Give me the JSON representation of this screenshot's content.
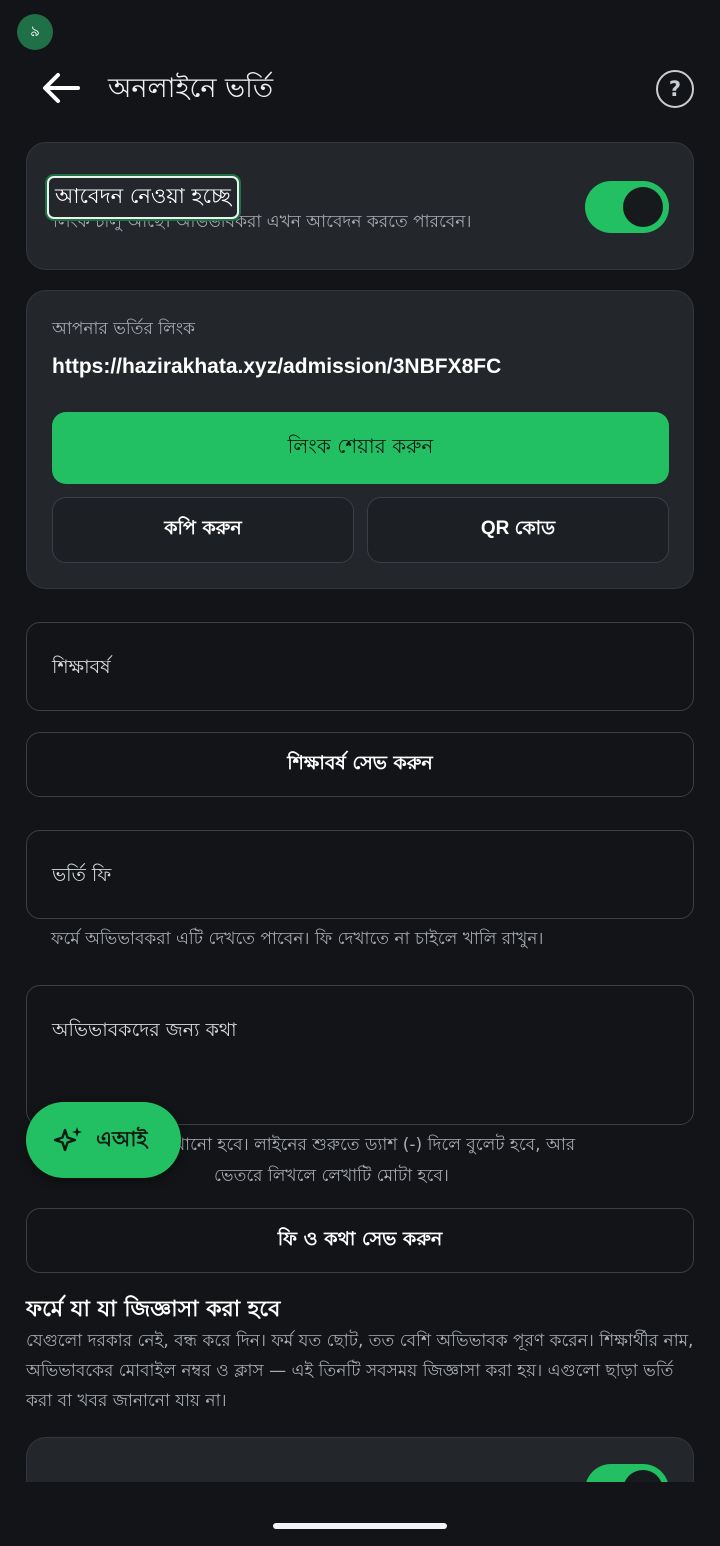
{
  "status_bar": {
    "badge": "৯"
  },
  "header": {
    "title": "অনলাইনে ভর্তি",
    "help": "?"
  },
  "admission_status": {
    "title": "আবেদন নেওয়া হচ্ছে",
    "subtitle": "লিংক চালু আছে। অভিভাবকরা এখন আবেদন করতে পারবেন।",
    "enabled": true
  },
  "link_card": {
    "label": "আপনার ভর্তির লিংক",
    "url": "https://hazirakhata.xyz/admission/3NBFX8FC",
    "share_label": "লিংক শেয়ার করুন",
    "copy_label": "কপি করুন",
    "qr_label": "QR কোড"
  },
  "academic_year": {
    "placeholder": "শিক্ষাবর্ষ",
    "save_label": "শিক্ষাবর্ষ সেভ করুন"
  },
  "admission_fee": {
    "placeholder": "ভর্তি ফি",
    "helper": "ফর্মে অভিভাবকরা এটি দেখতে পাবেন। ফি দেখাতে না চাইলে খালি রাখুন।"
  },
  "parent_note": {
    "placeholder": "অভিভাবকদের জন্য কথা",
    "helper_line1": "খানো হবে। লাইনের শুরুতে ড্যাশ (-) দিলে বুলেট হবে, আর",
    "helper_line2": "ভেতরে লিখলে লেখাটি মোটা হবে।",
    "save_label": "ফি ও কথা সেভ করুন"
  },
  "ai_fab": {
    "label": "এআই",
    "icon": "sparkle-icon"
  },
  "questions_section": {
    "title": "ফর্মে যা যা জিজ্ঞাসা করা হবে",
    "body": "যেগুলো দরকার নেই, বন্ধ করে দিন। ফর্ম যত ছোট, তত বেশি অভিভাবক পূরণ করেন। শিক্ষার্থীর নাম, অভিভাবকের মোবাইল নম্বর ও ক্লাস — এই তিনটি সবসময় জিজ্ঞাসা করা হয়। এগুলো ছাড়া ভর্তি করা বা খবর জানানো যায় না।",
    "first_item_enabled": true
  },
  "colors": {
    "background": "#121417",
    "card": "#23262b",
    "accent": "#22c063"
  }
}
